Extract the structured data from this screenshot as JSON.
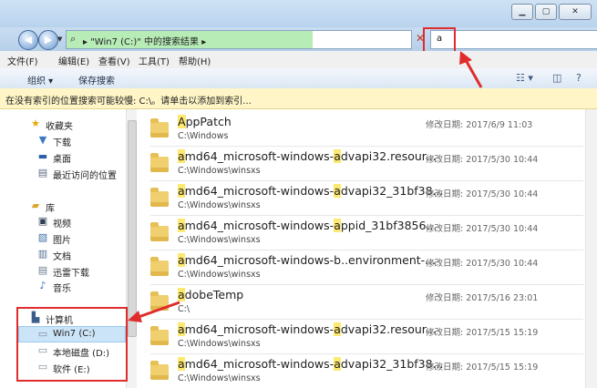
{
  "window": {
    "caption_buttons": [
      "minimize-icon",
      "maximize-icon",
      "close-icon"
    ]
  },
  "address_bar": {
    "breadcrumb": "▸ \"Win7 (C:)\" 中的搜索结果 ▸",
    "search_value": "a"
  },
  "menu": [
    "文件(F)",
    "编辑(E)",
    "查看(V)",
    "工具(T)",
    "帮助(H)"
  ],
  "toolbar": {
    "organize": "组织 ▾",
    "save_search": "保存搜索"
  },
  "info_bar": "在没有索引的位置搜索可能较慢: C:\\。请单击以添加到索引...",
  "nav": {
    "favorites": "收藏夹",
    "download": "下载",
    "desktop": "桌面",
    "recent": "最近访问的位置",
    "library": "库",
    "video": "视频",
    "pictures": "图片",
    "documents": "文档",
    "xunlei": "迅雷下载",
    "music": "音乐",
    "computer": "计算机",
    "drive_c": "Win7 (C:)",
    "drive_d": "本地磁盘 (D:)",
    "drive_e": "软件 (E:)"
  },
  "date_label": "修改日期:",
  "results": [
    {
      "pre": "",
      "hl": "A",
      "post": "ppPatch",
      "path": "C:\\Windows",
      "date": "2017/6/9 11:03"
    },
    {
      "pre": "",
      "hl": "a",
      "post": "md64_microsoft-windows-advapi32.resour...",
      "path": "C:\\Windows\\winsxs",
      "date": "2017/5/30 10:44"
    },
    {
      "pre": "",
      "hl": "a",
      "post": "md64_microsoft-windows-advapi32_31bf38...",
      "path": "C:\\Windows\\winsxs",
      "date": "2017/5/30 10:44"
    },
    {
      "pre": "",
      "hl": "a",
      "post": "md64_microsoft-windows-appid_31bf3856...",
      "path": "C:\\Windows\\winsxs",
      "date": "2017/5/30 10:44"
    },
    {
      "pre": "",
      "hl": "a",
      "post": "md64_microsoft-windows-b..environment-...",
      "path": "C:\\Windows\\winsxs",
      "date": "2017/5/30 10:44"
    },
    {
      "pre": "",
      "hl": "a",
      "post": "dobeTemp",
      "path": "C:\\",
      "date": "2017/5/16 23:01"
    },
    {
      "pre": "",
      "hl": "a",
      "post": "md64_microsoft-windows-advapi32.resour...",
      "path": "C:\\Windows\\winsxs",
      "date": "2017/5/15 15:19"
    },
    {
      "pre": "",
      "hl": "a",
      "post": "md64_microsoft-windows-advapi32_31bf38...",
      "path": "C:\\Windows\\winsxs",
      "date": "2017/5/15 15:19"
    }
  ],
  "colors": {
    "highlight": "#fde870",
    "annotation_red": "#e02c2c",
    "selection": "#cce4f7",
    "info_bar": "#fff5c6"
  }
}
